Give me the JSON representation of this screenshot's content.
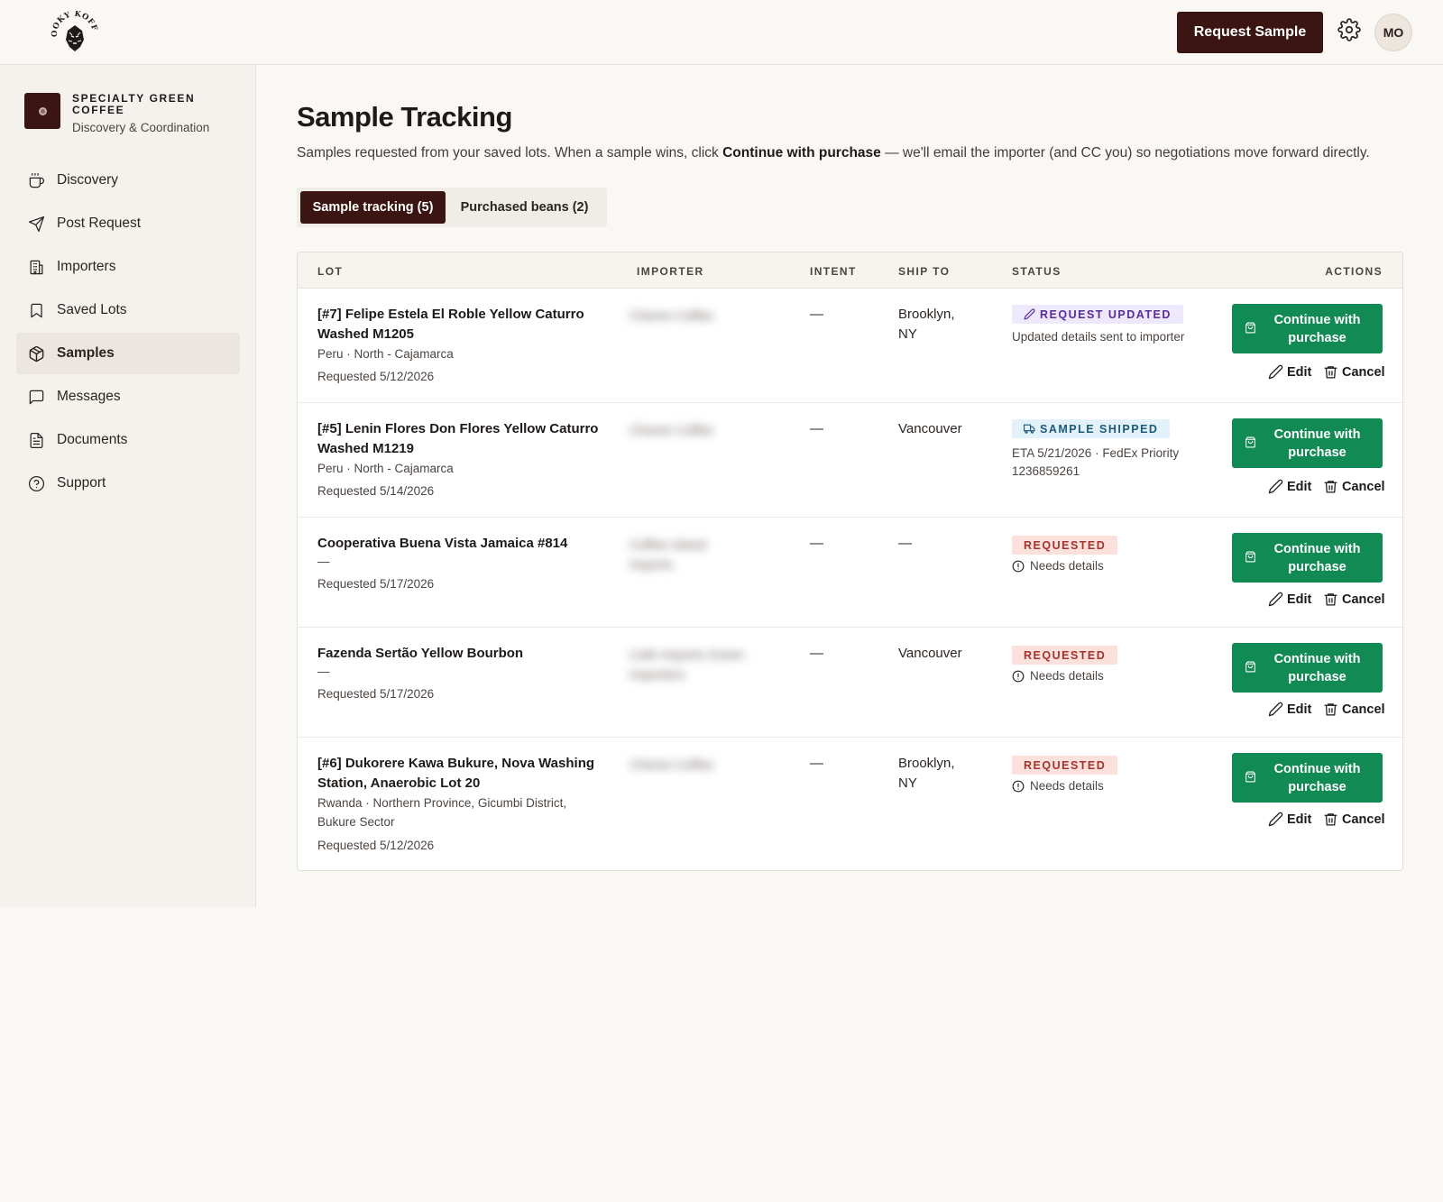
{
  "header": {
    "logo_text": "KOOKY KOFFEE",
    "request_sample_label": "Request Sample",
    "avatar_initials": "MO"
  },
  "sidebar": {
    "brand_name": "SPECIALTY GREEN COFFEE",
    "brand_sub": "Discovery & Coordination",
    "items": [
      {
        "label": "Discovery",
        "icon": "coffee-cup-icon",
        "active": false
      },
      {
        "label": "Post Request",
        "icon": "send-icon",
        "active": false
      },
      {
        "label": "Importers",
        "icon": "building-icon",
        "active": false
      },
      {
        "label": "Saved Lots",
        "icon": "bookmark-icon",
        "active": false
      },
      {
        "label": "Samples",
        "icon": "package-icon",
        "active": true
      },
      {
        "label": "Messages",
        "icon": "message-icon",
        "active": false
      },
      {
        "label": "Documents",
        "icon": "document-icon",
        "active": false
      },
      {
        "label": "Support",
        "icon": "help-circle-icon",
        "active": false
      }
    ]
  },
  "main": {
    "title": "Sample Tracking",
    "desc_pre": "Samples requested from your saved lots. When a sample wins, click ",
    "desc_bold": "Continue with purchase",
    "desc_post": " — we'll email the importer (and CC you) so negotiations move forward directly.",
    "tabs": [
      {
        "label": "Sample tracking (5)",
        "active": true
      },
      {
        "label": "Purchased beans (2)",
        "active": false
      }
    ]
  },
  "table": {
    "columns": [
      "LOT",
      "IMPORTER",
      "INTENT",
      "SHIP TO",
      "STATUS",
      "ACTIONS"
    ],
    "action_primary": "Continue with purchase",
    "action_edit": "Edit",
    "action_cancel": "Cancel",
    "rows": [
      {
        "title": "[#7] Felipe Estela El Roble Yellow Caturro Washed M1205",
        "origin": "Peru · North - Cajamarca",
        "requested": "Requested 5/12/2026",
        "importer": "Cheme Coffee",
        "intent": "—",
        "ship_to": "Brooklyn, NY",
        "status": "REQUEST UPDATED",
        "status_kind": "updated",
        "status_note": "Updated details sent to importer"
      },
      {
        "title": "[#5] Lenin Flores Don Flores Yellow Caturro Washed M1219",
        "origin": "Peru · North - Cajamarca",
        "requested": "Requested 5/14/2026",
        "importer": "Cheme Coffee",
        "intent": "—",
        "ship_to": "Vancouver",
        "status": "SAMPLE SHIPPED",
        "status_kind": "shipped",
        "status_note": "ETA 5/21/2026 · FedEx Priority 1236859261"
      },
      {
        "title": "Cooperativa Buena Vista Jamaica #814",
        "origin": "—",
        "requested": "Requested 5/17/2026",
        "importer": "Coffee Island Imports",
        "intent": "—",
        "ship_to": "—",
        "status": "REQUESTED",
        "status_kind": "requested",
        "status_note": "Needs details"
      },
      {
        "title": "Fazenda Sertão Yellow Bourbon",
        "origin": "—",
        "requested": "Requested 5/17/2026",
        "importer": "Cafe Imports Green Importers",
        "intent": "—",
        "ship_to": "Vancouver",
        "status": "REQUESTED",
        "status_kind": "requested",
        "status_note": "Needs details"
      },
      {
        "title": "[#6] Dukorere Kawa Bukure, Nova Washing Station, Anaerobic Lot 20",
        "origin": "Rwanda · Northern Province, Gicumbi District, Bukure Sector",
        "requested": "Requested 5/12/2026",
        "importer": "Cheme Coffee",
        "intent": "—",
        "ship_to": "Brooklyn, NY",
        "status": "REQUESTED",
        "status_kind": "requested",
        "status_note": "Needs details"
      }
    ]
  },
  "colors": {
    "brand_dark": "#3a1512",
    "action_green": "#118a54",
    "updated_badge": "#5a2c97",
    "shipped_badge": "#1d5a7a",
    "requested_badge": "#a3332c"
  }
}
